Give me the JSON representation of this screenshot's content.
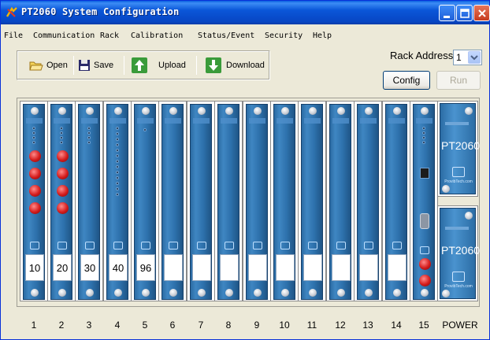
{
  "window": {
    "title": "PT2060 System Configuration"
  },
  "menu": [
    "File",
    "Communication",
    "Rack",
    "Calibration",
    "Status/Event",
    "Security",
    "Help"
  ],
  "toolbar": {
    "open": "Open",
    "save": "Save",
    "upload": "Upload",
    "download": "Download"
  },
  "rack_address": {
    "label": "Rack Address:",
    "value": "1"
  },
  "buttons": {
    "config": "Config",
    "run": "Run"
  },
  "slots": [
    {
      "number": "1",
      "label": "10"
    },
    {
      "number": "2",
      "label": "20"
    },
    {
      "number": "3",
      "label": "30"
    },
    {
      "number": "4",
      "label": "40"
    },
    {
      "number": "5",
      "label": "96"
    },
    {
      "number": "6",
      "label": ""
    },
    {
      "number": "7",
      "label": ""
    },
    {
      "number": "8",
      "label": ""
    },
    {
      "number": "9",
      "label": ""
    },
    {
      "number": "10",
      "label": ""
    },
    {
      "number": "11",
      "label": ""
    },
    {
      "number": "12",
      "label": ""
    },
    {
      "number": "13",
      "label": ""
    },
    {
      "number": "14",
      "label": ""
    },
    {
      "number": "15",
      "label": ""
    }
  ],
  "power": {
    "label": "POWER",
    "model": "PT2060",
    "website": "ProvibTech.com"
  },
  "colors": {
    "title_bar": "#0A56D8",
    "card_blue": "#2E72AD",
    "connector_red": "#D41C1C"
  }
}
